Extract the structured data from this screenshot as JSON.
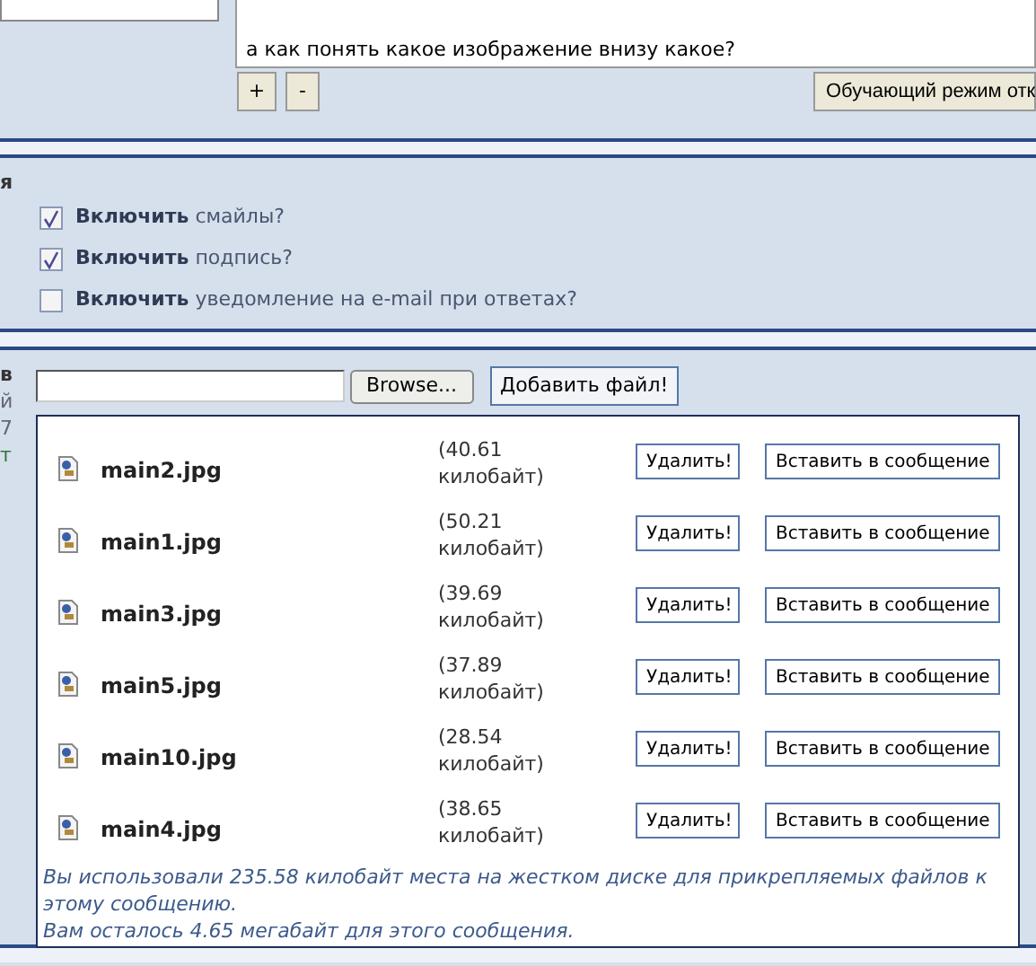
{
  "editor": {
    "text": "а как понять какое изображение внизу какое?",
    "zoom_in": "+",
    "zoom_out": "-",
    "mode_button": "Обучающий режим отк"
  },
  "options": {
    "heading": "я",
    "items": [
      {
        "bold": "Включить",
        "label": "смайлы?",
        "checked": true
      },
      {
        "bold": "Включить",
        "label": "подпись?",
        "checked": true
      },
      {
        "bold": "Включить",
        "label": "уведомление на e-mail при ответах?",
        "checked": false
      }
    ]
  },
  "attachments": {
    "side_labels": [
      "в",
      "й",
      "7",
      "т"
    ],
    "browse": "Browse...",
    "add_button": "Добавить файл!",
    "files": [
      {
        "name": "main2.jpg",
        "size": "(40.61 килобайт)",
        "delete": "Удалить!",
        "insert": "Вставить в сообщение"
      },
      {
        "name": "main1.jpg",
        "size": "(50.21 килобайт)",
        "delete": "Удалить!",
        "insert": "Вставить в сообщение"
      },
      {
        "name": "main3.jpg",
        "size": "(39.69 килобайт)",
        "delete": "Удалить!",
        "insert": "Вставить в сообщение"
      },
      {
        "name": "main5.jpg",
        "size": "(37.89 килобайт)",
        "delete": "Удалить!",
        "insert": "Вставить в сообщение"
      },
      {
        "name": "main10.jpg",
        "size": "(28.54 килобайт)",
        "delete": "Удалить!",
        "insert": "Вставить в сообщение"
      },
      {
        "name": "main4.jpg",
        "size": "(38.65 килобайт)",
        "delete": "Удалить!",
        "insert": "Вставить в сообщение"
      }
    ],
    "usage": "Вы использовали 235.58 килобайт места на жестком диске для прикрепляемых файлов к этому сообщению.",
    "remaining": "Вам осталось 4.65 мегабайт для этого сообщения."
  }
}
